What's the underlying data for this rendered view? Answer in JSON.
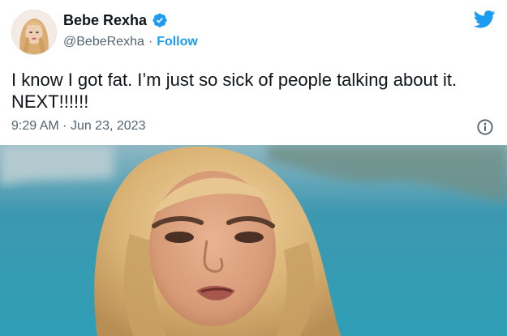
{
  "tweet": {
    "display_name": "Bebe Rexha",
    "handle": "@BebeRexha",
    "separator": "·",
    "follow_label": "Follow",
    "text": "I know I got fat. I’m just so sick of people talking about it.\nNEXT!!!!!!",
    "time": "9:29 AM",
    "date": "Jun 23, 2023",
    "meta_separator": "·"
  },
  "icons": {
    "verified": "verified-badge-icon",
    "brand": "twitter-bird-icon",
    "info": "info-icon"
  },
  "colors": {
    "accent": "#1d9bf0",
    "text_primary": "#0f1419",
    "text_secondary": "#536471"
  }
}
